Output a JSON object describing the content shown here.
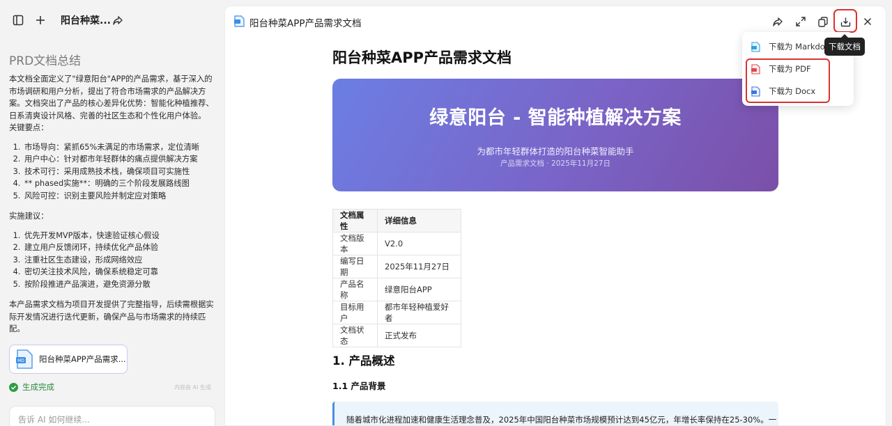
{
  "left_panel": {
    "conversation_title": "阳台种菜...",
    "summary_heading": "PRD文档总结",
    "intro": "本文档全面定义了\"绿意阳台\"APP的产品需求，基于深入的市场调研和用户分析，提出了符合市场需求的产品解决方案。文档突出了产品的核心差异化优势：智能化种植推荐、日系清爽设计风格、完善的社区生态和个性化用户体验。",
    "key_points_label": "关键要点：",
    "key_points": [
      "市场导向：紧抓65%未满足的市场需求，定位清晰",
      "用户中心：针对都市年轻群体的痛点提供解决方案",
      "技术可行：采用成熟技术栈，确保项目可实施性",
      "** phased实施**：明确的三个阶段发展路线图",
      "风险可控：识别主要风险并制定应对策略"
    ],
    "suggestions_label": "实施建议：",
    "suggestions": [
      "优先开发MVP版本，快速验证核心假设",
      "建立用户反馈闭环，持续优化产品体验",
      "注重社区生态建设，形成网络效应",
      "密切关注技术风险，确保系统稳定可靠",
      "按阶段推进产品演进，避免资源分散"
    ],
    "closing": "本产品需求文档为项目开发提供了完整指导，后续需根据实际开发情况进行迭代更新，确保产品与市场需求的持续匹配。",
    "file_card_name": "阳台种菜APP产品需求...",
    "status_text": "生成完成",
    "status_note": "内容由 AI 生成",
    "input_placeholder": "告诉 AI 如何继续..."
  },
  "doc_panel": {
    "header_title": "阳台种菜APP产品需求文档",
    "doc_title": "阳台种菜APP产品需求文档",
    "banner": {
      "title": "绿意阳台 - 智能种植解决方案",
      "subtitle": "为都市年轻群体打造的阳台种菜智能助手",
      "date_line": "产品需求文档 · 2025年11月27日"
    },
    "table": {
      "headers": [
        "文档属性",
        "详细信息"
      ],
      "rows": [
        [
          "文档版本",
          "V2.0"
        ],
        [
          "编写日期",
          "2025年11月27日"
        ],
        [
          "产品名称",
          "绿意阳台APP"
        ],
        [
          "目标用户",
          "都市年轻种植爱好者"
        ],
        [
          "文档状态",
          "正式发布"
        ]
      ]
    },
    "section_heading": "1. 产品概述",
    "subsection_heading": "1.1 产品背景",
    "quote_text": "随着城市化进程加速和健康生活理念普及，2025年中国阳台种菜市场规模预计达到45亿元，年增长率保持在25-30%。一"
  },
  "download_menu": {
    "tooltip": "下载文档",
    "items": [
      "下载为 Markdown",
      "下载为 PDF",
      "下载为 Docx"
    ]
  },
  "colors": {
    "banner_start": "#6c7ee3",
    "banner_end": "#7b4fa8",
    "highlight_red": "#d9332f",
    "status_green": "#2e8b3e",
    "quote_bg": "#ecf4fc",
    "quote_border": "#4a8fe0"
  }
}
